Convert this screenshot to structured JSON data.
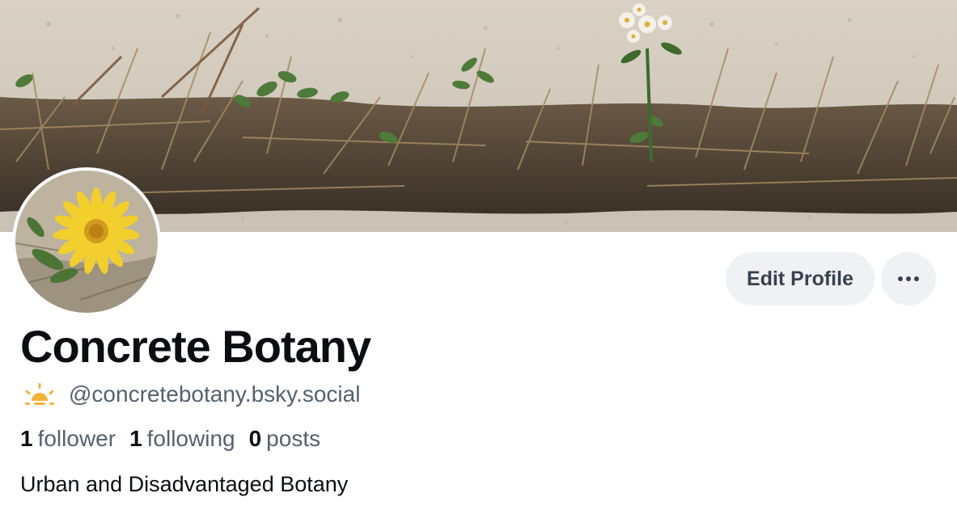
{
  "profile": {
    "display_name": "Concrete Botany",
    "handle": "@concretebotany.bsky.social",
    "handle_icon": "sunrise-icon",
    "bio": "Urban and Disadvantaged Botany",
    "stats": {
      "followers_count": "1",
      "followers_label": "follower",
      "following_count": "1",
      "following_label": "following",
      "posts_count": "0",
      "posts_label": "posts"
    }
  },
  "actions": {
    "edit_profile_label": "Edit Profile",
    "more_icon": "ellipsis-icon"
  },
  "colors": {
    "text_primary": "#0b0f14",
    "text_secondary": "#546170",
    "button_bg": "#eff1f4",
    "sun_icon": "#f0b43a"
  }
}
